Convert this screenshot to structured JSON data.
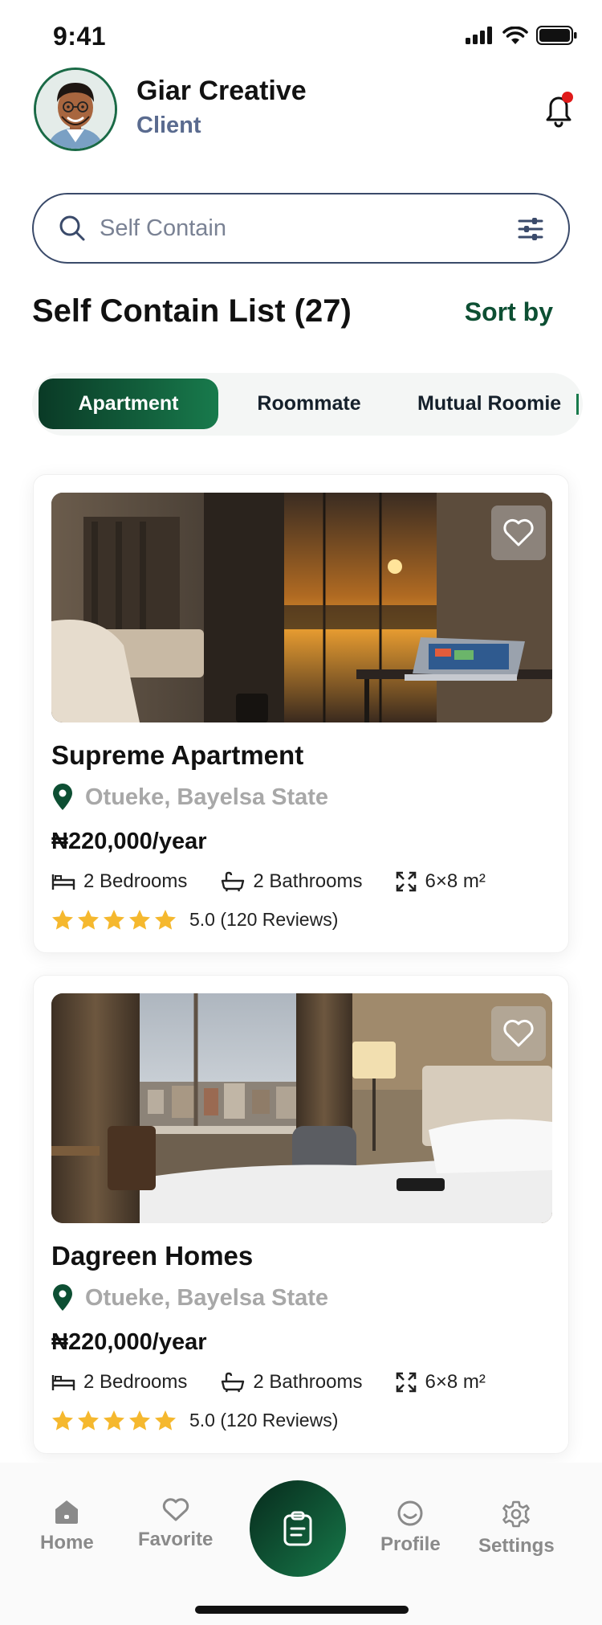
{
  "status_bar": {
    "time": "9:41"
  },
  "header": {
    "user_name": "Giar Creative",
    "user_role": "Client",
    "avatar_icon": "avatar-image",
    "notification_icon": "bell-icon",
    "notification_dot_color": "#e01a1a"
  },
  "search": {
    "placeholder": "Self Contain",
    "search_icon": "search-icon",
    "filter_icon": "sliders-icon"
  },
  "list": {
    "title": "Self Contain List (27)",
    "sort_label": "Sort by"
  },
  "tabs": [
    {
      "label": "Apartment",
      "active": true
    },
    {
      "label": "Roommate",
      "active": false
    },
    {
      "label": "Mutual Roomie",
      "active": false
    }
  ],
  "listings": [
    {
      "title": "Supreme Apartment",
      "location": "Otueke, Bayelsa State",
      "price": "₦220,000/year",
      "bedrooms": "2 Bedrooms",
      "bathrooms": "2 Bathrooms",
      "area": "6×8 m²",
      "rating_text": "5.0 (120 Reviews)",
      "stars": 5
    },
    {
      "title": "Dagreen Homes",
      "location": "Otueke, Bayelsa State",
      "price": "₦220,000/year",
      "bedrooms": "2 Bedrooms",
      "bathrooms": "2 Bathrooms",
      "area": "6×8 m²",
      "rating_text": "5.0 (120 Reviews)",
      "stars": 5
    }
  ],
  "bottom_nav": {
    "items": [
      {
        "label": "Home",
        "icon": "home-icon"
      },
      {
        "label": "Favorite",
        "icon": "heart-icon"
      },
      {
        "label": "",
        "icon": "clipboard-icon"
      },
      {
        "label": "Profile",
        "icon": "smile-icon"
      },
      {
        "label": "Settings",
        "icon": "gear-icon"
      }
    ]
  },
  "colors": {
    "brand_green": "#0d4f33",
    "accent_green": "#187a4c",
    "star": "#f5b82e",
    "muted_text": "#a8a8a8",
    "role_text": "#5a6b8f"
  }
}
